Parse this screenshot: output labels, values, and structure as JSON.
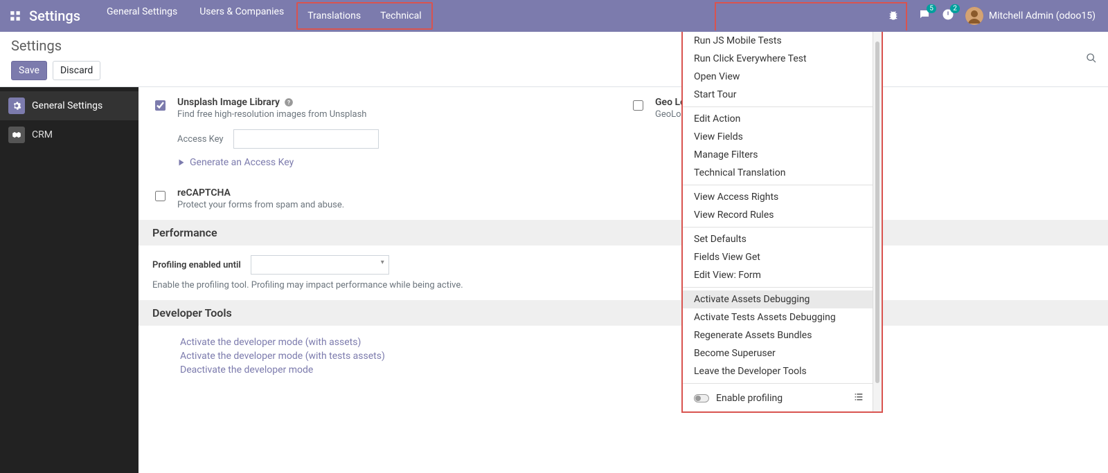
{
  "topbar": {
    "app_title": "Settings",
    "nav": {
      "general": "General Settings",
      "users": "Users & Companies",
      "translations": "Translations",
      "technical": "Technical"
    },
    "messages_badge": "5",
    "activities_badge": "2",
    "user_name": "Mitchell Admin (odoo15)"
  },
  "control_panel": {
    "breadcrumb": "Settings",
    "save": "Save",
    "discard": "Discard"
  },
  "sidebar": {
    "general": "General Settings",
    "crm": "CRM"
  },
  "settings": {
    "unsplash": {
      "title": "Unsplash Image Library",
      "desc": "Find free high-resolution images from Unsplash",
      "access_key_label": "Access Key",
      "access_key_value": "",
      "generate_link": "Generate an Access Key",
      "checked": true
    },
    "geo": {
      "title": "Geo Localization",
      "desc": "GeoLocalize your partn",
      "checked": false
    },
    "recaptcha": {
      "title": "reCAPTCHA",
      "desc": "Protect your forms from spam and abuse.",
      "checked": false
    },
    "performance": {
      "header": "Performance",
      "profiling_label": "Profiling enabled until",
      "profiling_desc": "Enable the profiling tool. Profiling may impact performance while being active."
    },
    "developer": {
      "header": "Developer Tools",
      "link_assets": "Activate the developer mode (with assets)",
      "link_tests": "Activate the developer mode (with tests assets)",
      "link_deactivate": "Deactivate the developer mode"
    }
  },
  "debug_menu": {
    "items_g1": [
      "Run JS Mobile Tests",
      "Run Click Everywhere Test",
      "Open View",
      "Start Tour"
    ],
    "items_g2": [
      "Edit Action",
      "View Fields",
      "Manage Filters",
      "Technical Translation"
    ],
    "items_g3": [
      "View Access Rights",
      "View Record Rules"
    ],
    "items_g4": [
      "Set Defaults",
      "Fields View Get",
      "Edit View: Form"
    ],
    "items_g5": [
      "Activate Assets Debugging",
      "Activate Tests Assets Debugging",
      "Regenerate Assets Bundles",
      "Become Superuser",
      "Leave the Developer Tools"
    ],
    "toggle_label": "Enable profiling",
    "hover_item": "Activate Assets Debugging"
  }
}
